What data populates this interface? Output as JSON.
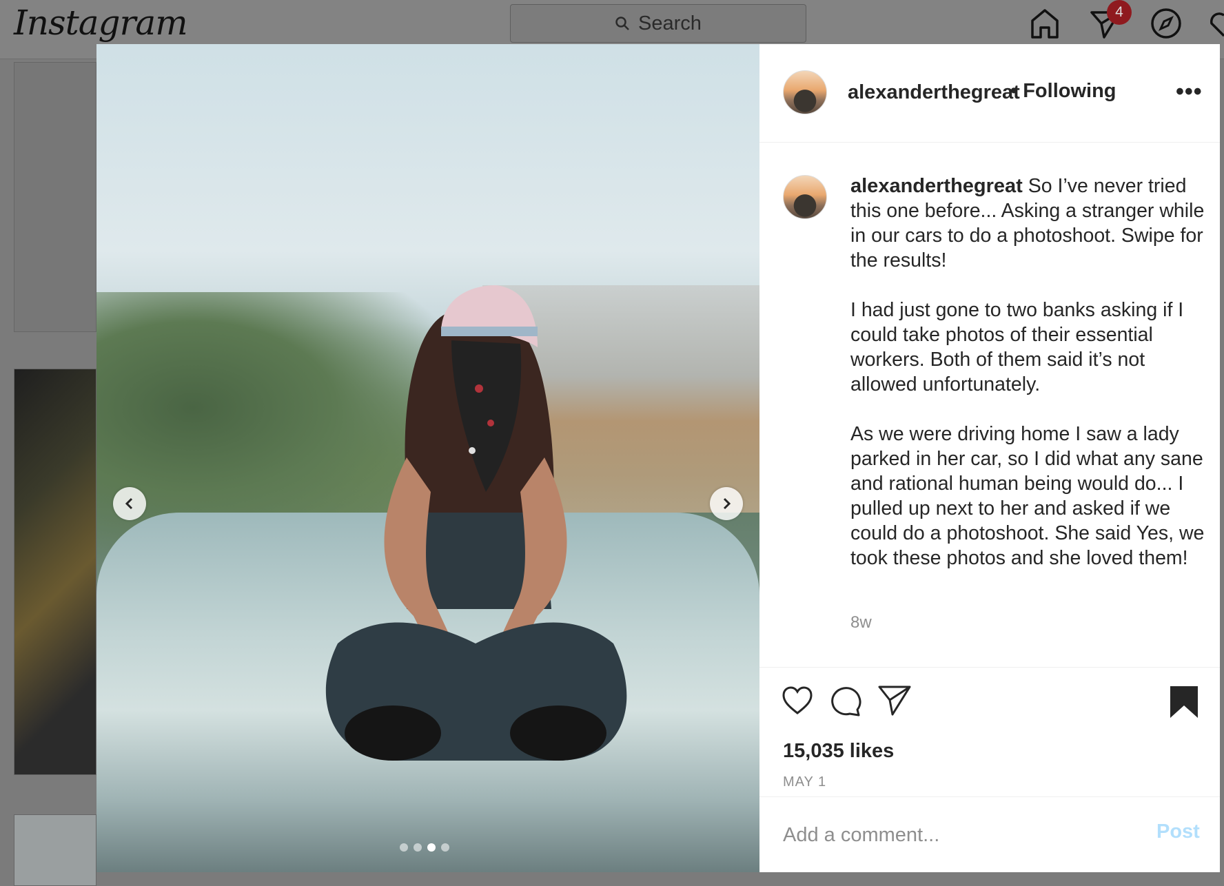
{
  "app": {
    "logo_text": "Instagram",
    "search_placeholder": "Search",
    "notification_count": "4"
  },
  "post": {
    "username": "alexanderthegreat",
    "follow_status": "• Following",
    "more_label": "•••",
    "caption_username": "alexanderthegreat",
    "caption_paragraphs": [
      "So I’ve never tried this one before... Asking a stranger while in our cars to do a photoshoot. Swipe for the results!",
      "I had just gone to two banks asking if I could take photos of their essential workers. Both of them said it’s not allowed unfortunately.",
      "As we were driving home I saw a lady parked in her car, so I did what any sane and rational human being would do... I pulled up next to her and asked if we could do a photoshoot. She said Yes, we took these photos and she loved them!"
    ],
    "time_ago": "8w",
    "likes": "15,035 likes",
    "date": "MAY 1",
    "comment_placeholder": "Add a comment...",
    "post_button": "Post",
    "carousel_total": 4,
    "carousel_active_index": 3
  },
  "colors": {
    "post_button": "#b2dffc",
    "badge": "#8f1a1f",
    "muted": "#8e8e8e"
  },
  "icons": [
    "home-icon",
    "direct-messages-icon",
    "explore-icon",
    "activity-heart-icon",
    "like-heart-icon",
    "comment-icon",
    "share-icon",
    "bookmark-icon",
    "chevron-left-icon",
    "chevron-right-icon",
    "more-icon"
  ]
}
